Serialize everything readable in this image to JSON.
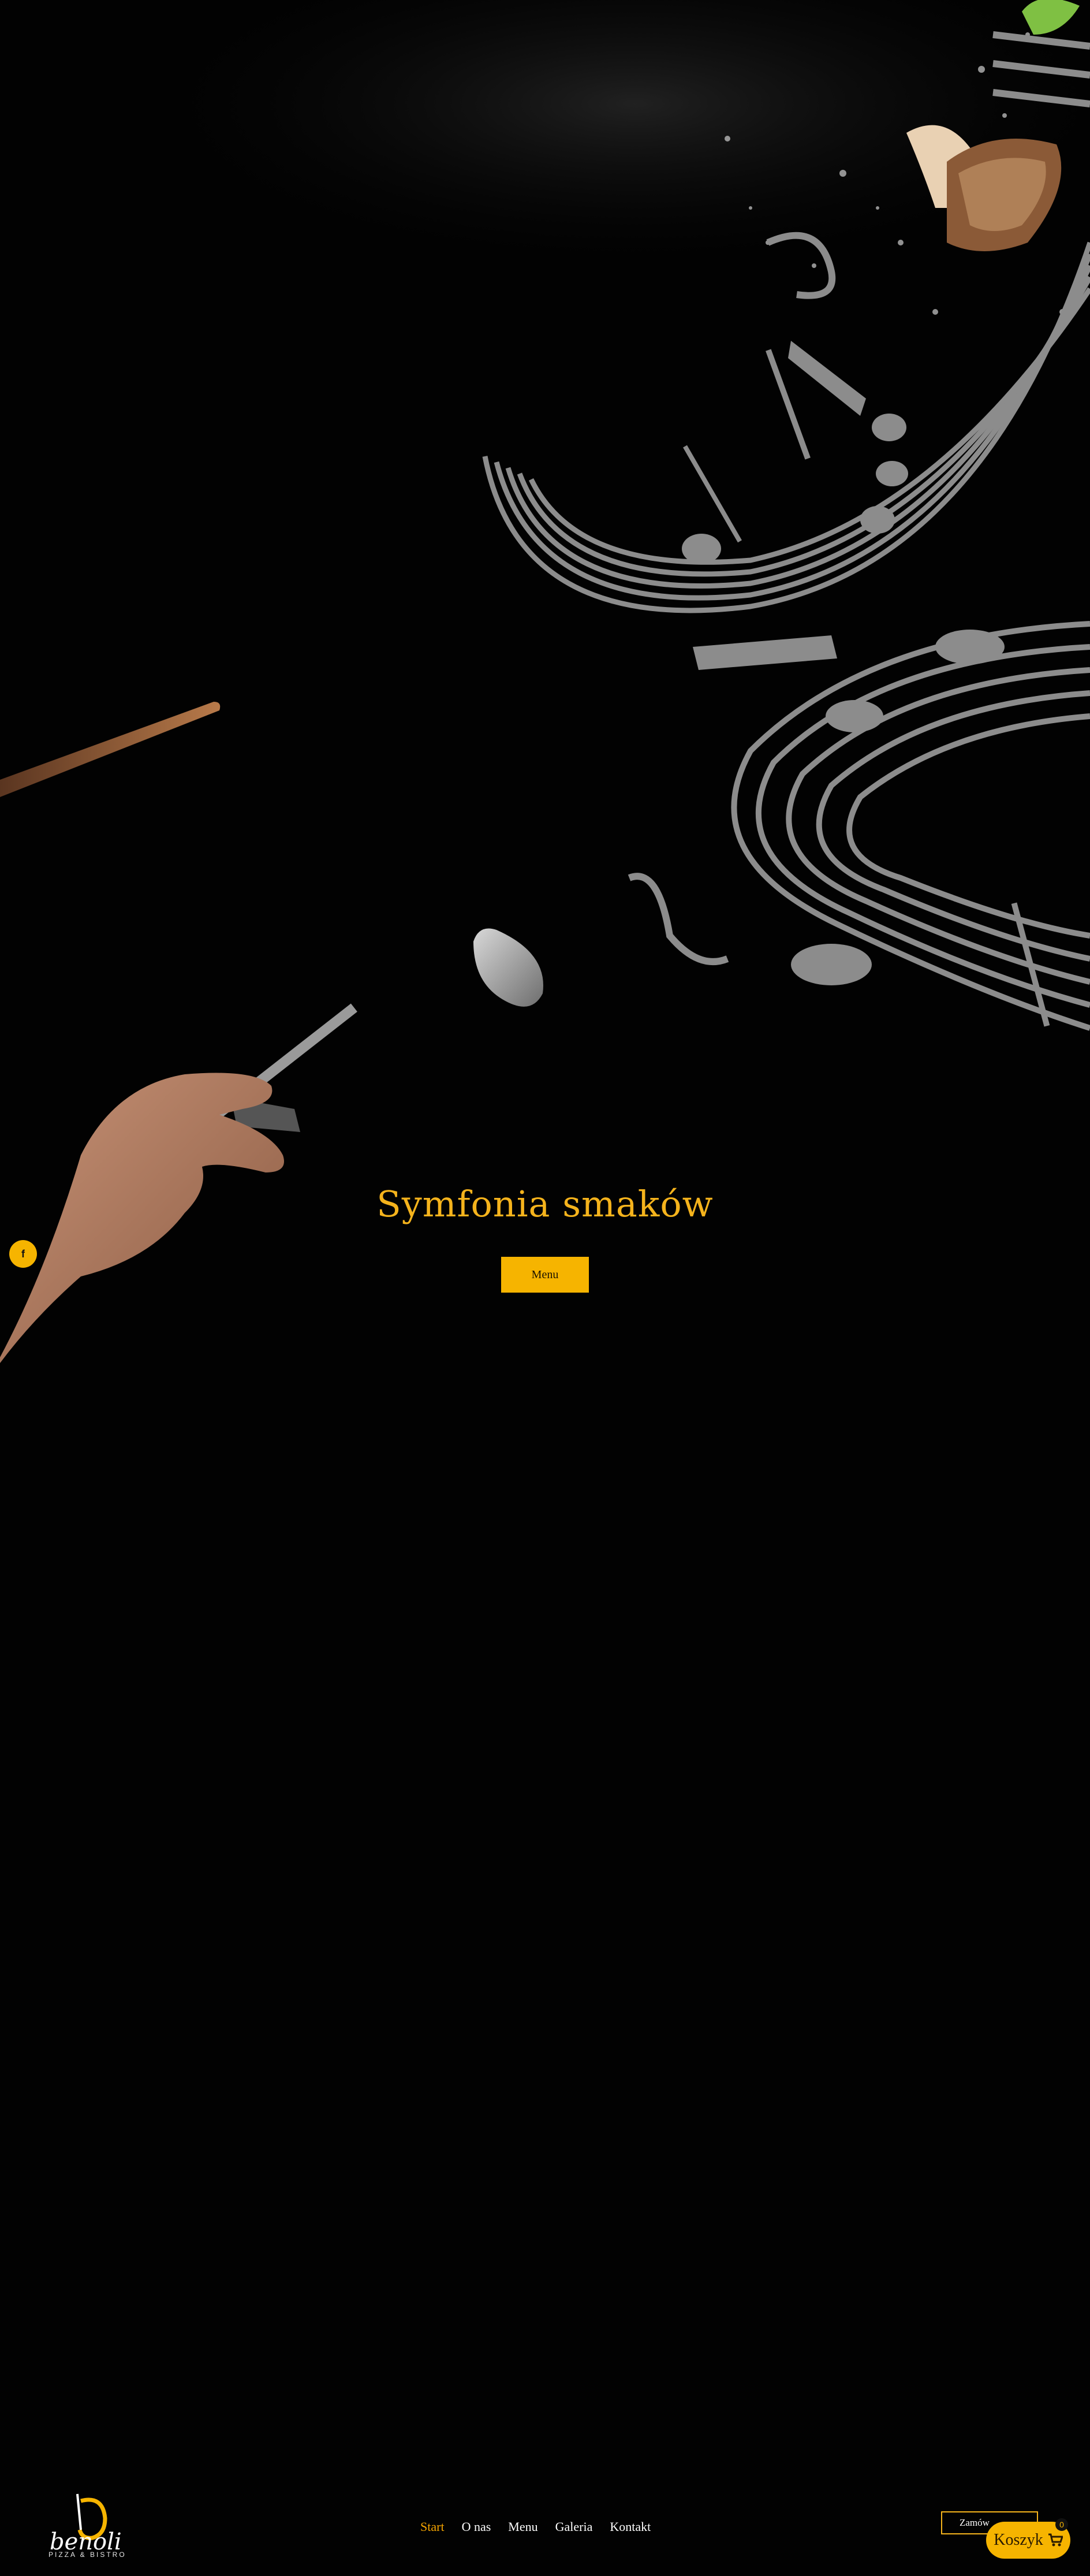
{
  "hero": {
    "title": "Symfonia smaków",
    "button_label": "Menu"
  },
  "social": {
    "facebook_glyph": "f",
    "icon": "facebook-icon"
  },
  "nav": {
    "logo_text": "benoli",
    "logo_subtitle": "PIZZA & BISTRO",
    "items": [
      {
        "label": "Start",
        "active": true
      },
      {
        "label": "O nas",
        "active": false
      },
      {
        "label": "Menu",
        "active": false
      },
      {
        "label": "Galeria",
        "active": false
      },
      {
        "label": "Kontakt",
        "active": false
      }
    ],
    "order_label": "Zamów",
    "cart_label": "Koszyk",
    "cart_count": "0",
    "cart_icon": "cart-icon"
  },
  "colors": {
    "accent": "#f6b400",
    "background": "#020202",
    "nav_active": "#f5a400"
  }
}
